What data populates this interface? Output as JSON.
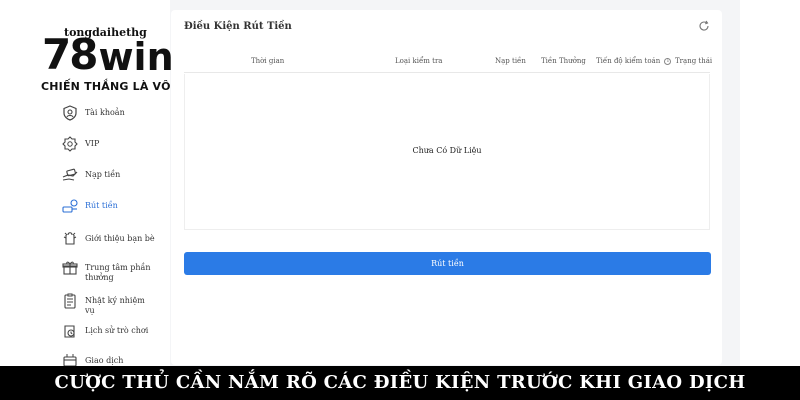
{
  "brand": {
    "site": "tongdaihethg",
    "logo_num": "78",
    "logo_word": "win",
    "slogan": "CHIẾN THẮNG LÀ VÔ HẠN"
  },
  "sidebar": {
    "items": [
      {
        "label": "Tài khoản",
        "icon": "user-shield-icon",
        "active": false
      },
      {
        "label": "VIP",
        "icon": "vip-badge-icon",
        "active": false
      },
      {
        "label": "Nạp tiền",
        "icon": "deposit-icon",
        "active": false
      },
      {
        "label": "Rút tiền",
        "icon": "withdraw-icon",
        "active": true
      },
      {
        "label": "Giới thiệu bạn bè",
        "icon": "refer-friend-icon",
        "active": false
      },
      {
        "label": "Trung tâm phần thưởng",
        "icon": "gift-icon",
        "active": false
      },
      {
        "label": "Nhật ký nhiệm vụ",
        "icon": "task-log-icon",
        "active": false
      },
      {
        "label": "Lịch sử trò chơi",
        "icon": "game-history-icon",
        "active": false
      },
      {
        "label": "Giao dịch",
        "icon": "transaction-icon",
        "active": false
      }
    ],
    "active_color": "#2b6fd6"
  },
  "main": {
    "title": "Điều Kiện Rút Tiền",
    "columns": [
      "Thời gian",
      "Loại kiểm tra",
      "Nạp tiền",
      "Tiền Thưởng",
      "Tiến độ kiểm toán",
      "Trạng thái"
    ],
    "empty_text": "Chưa Có Dữ Liệu",
    "button_label": "Rút tiền",
    "button_color": "#2b7be6"
  },
  "banner": {
    "text": "CƯỢC THỦ CẦN NẮM RÕ CÁC ĐIỀU KIỆN TRƯỚC KHI GIAO DỊCH"
  }
}
